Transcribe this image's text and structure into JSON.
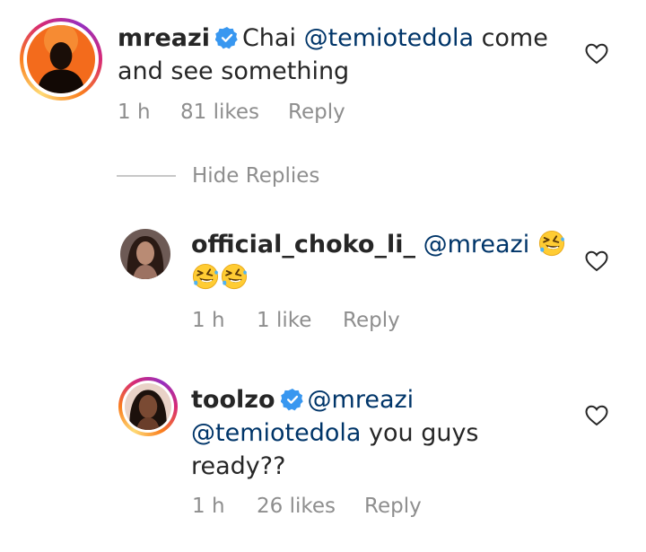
{
  "comments": [
    {
      "username": "mreazi",
      "text_parts": [
        "Chai ",
        "@temiotedola",
        " come and see something"
      ],
      "time": "1 h",
      "likes": "81 likes",
      "reply_label": "Reply"
    },
    {
      "username": "official_choko_li_",
      "mention": "@mreazi",
      "time": "1 h",
      "likes": "1 like",
      "reply_label": "Reply"
    },
    {
      "username": "toolzo",
      "mention1": "@mreazi",
      "mention2": "@temiotedola",
      "text_end": " you guys ready??",
      "time": "1 h",
      "likes": "26 likes",
      "reply_label": "Reply"
    }
  ],
  "hide_replies_label": "Hide Replies",
  "colors": {
    "mention": "#003569",
    "muted": "#8e8e8e",
    "verified": "#3897f0",
    "text": "#262626"
  },
  "icons": {
    "like": "heart-outline-icon",
    "verified": "verified-badge-icon",
    "emoji": "rolling-on-floor-laughing-emoji"
  }
}
